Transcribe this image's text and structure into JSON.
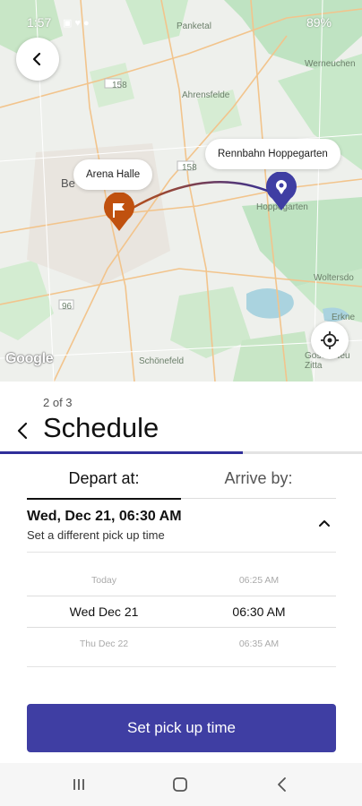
{
  "status_bar": {
    "time": "1:57",
    "battery": "89%",
    "icons": "▣ ♥ ●"
  },
  "map": {
    "origin_label": "Arena Halle",
    "destination_label": "Rennbahn Hoppegarten",
    "route_color": "#2f2e9a",
    "origin_color": "#c0510f",
    "destination_color": "#3f3ea3",
    "place_labels": [
      "Panketal",
      "Werneuchen",
      "Ahrensfelde",
      "Be",
      "Hoppegarten",
      "Woltersdo",
      "Erkne",
      "Schönefeld",
      "Gosen Neu Zitta"
    ],
    "road_numbers": [
      "158",
      "158",
      "96"
    ],
    "attribution": "Google"
  },
  "sheet": {
    "step": "2 of 3",
    "title": "Schedule",
    "progress_fraction": 0.67,
    "tabs": {
      "depart": "Depart at:",
      "arrive": "Arrive by:"
    },
    "selected_date": "Wed, Dec 21, 06:30 AM",
    "selected_hint": "Set a different pick up time",
    "picker": {
      "rows": [
        {
          "day": "Today",
          "time": "06:25 AM"
        },
        {
          "day": "Wed Dec 21",
          "time": "06:30 AM"
        },
        {
          "day": "Thu Dec 22",
          "time": "06:35 AM"
        }
      ]
    },
    "cta": "Set pick up time"
  },
  "icons": {
    "back": "arrow-left-icon",
    "locate": "crosshair-icon",
    "expand": "chevron-up-icon",
    "nav_recents": "recents-icon",
    "nav_home": "home-icon",
    "nav_back": "back-icon"
  },
  "colors": {
    "accent": "#3f3ea3",
    "progress_track": "#e3e3e3"
  }
}
